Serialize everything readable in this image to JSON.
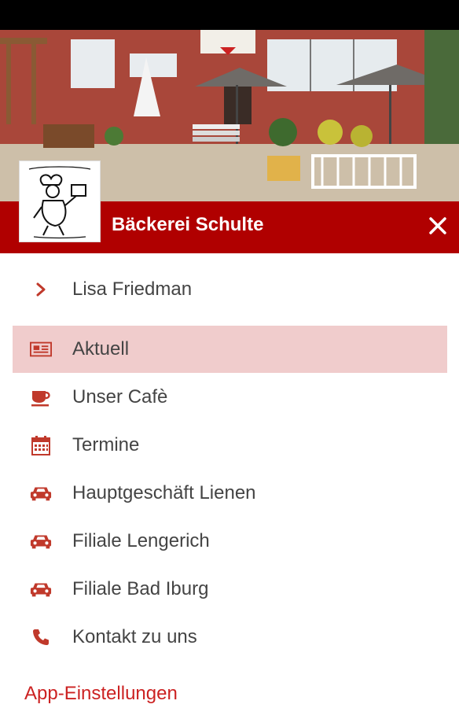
{
  "header": {
    "title": "Bäckerei Schulte"
  },
  "user": {
    "name": "Lisa Friedman"
  },
  "menu": {
    "items": [
      {
        "label": "Aktuell",
        "icon": "newspaper-icon",
        "active": true
      },
      {
        "label": "Unser Cafè",
        "icon": "coffee-cup-icon"
      },
      {
        "label": "Termine",
        "icon": "calendar-icon"
      },
      {
        "label": "Hauptgeschäft Lienen",
        "icon": "car-icon"
      },
      {
        "label": "Filiale Lengerich",
        "icon": "car-icon"
      },
      {
        "label": "Filiale Bad Iburg",
        "icon": "car-icon"
      },
      {
        "label": "Kontakt zu uns",
        "icon": "phone-icon"
      }
    ]
  },
  "footer": {
    "settings_label": "App-Einstellungen"
  },
  "colors": {
    "brand": "#b00000",
    "active_bg": "#f0cccc",
    "icon": "#c0392b"
  }
}
